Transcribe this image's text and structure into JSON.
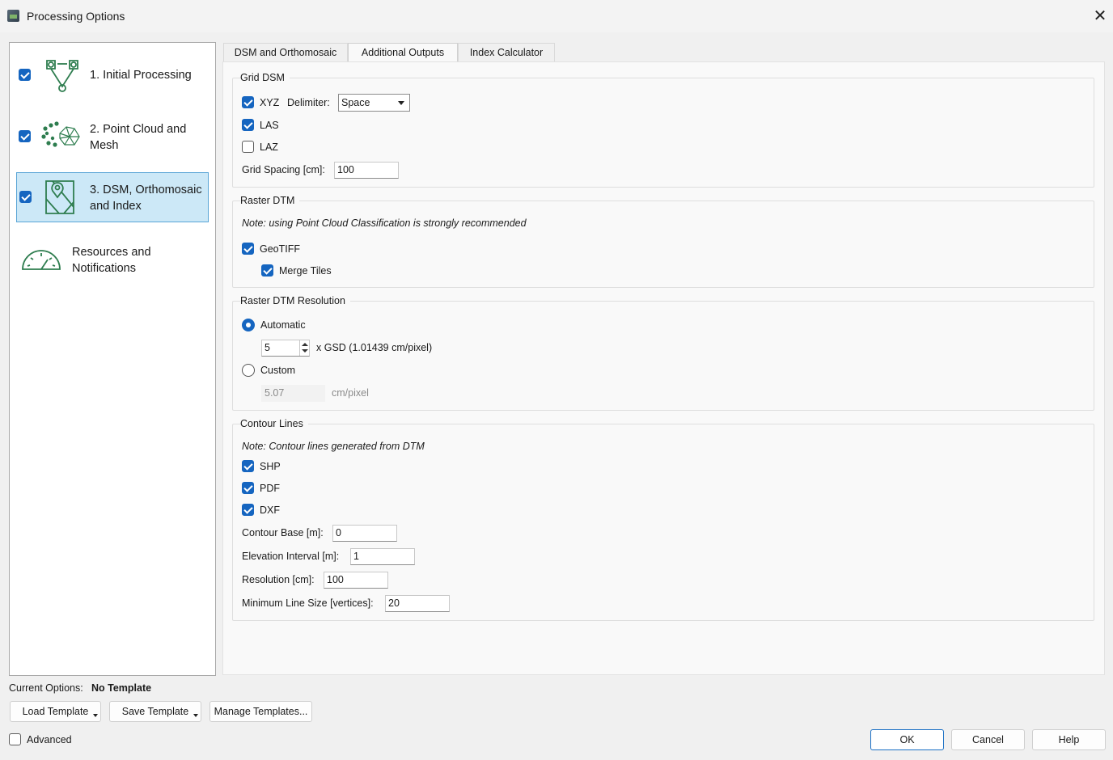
{
  "window": {
    "title": "Processing Options",
    "close_glyph": "✕"
  },
  "nav": {
    "items": [
      {
        "label_line1": "1. Initial Processing",
        "label_line2": "",
        "checked": true,
        "icon": "initial-processing-icon"
      },
      {
        "label_line1": "2. Point Cloud and",
        "label_line2": "Mesh",
        "checked": true,
        "icon": "point-cloud-icon"
      },
      {
        "label_line1": "3. DSM, Orthomosaic",
        "label_line2": "and Index",
        "checked": true,
        "selected": true,
        "icon": "dsm-map-icon"
      },
      {
        "label_line1": "Resources and",
        "label_line2": "Notifications",
        "icon": "gauge-icon"
      }
    ]
  },
  "tabs": [
    "DSM and Orthomosaic",
    "Additional Outputs",
    "Index Calculator"
  ],
  "active_tab": "Additional Outputs",
  "grid_dsm": {
    "title": "Grid DSM",
    "xyz_label": "XYZ",
    "xyz_checked": true,
    "delimiter_label": "Delimiter:",
    "delimiter_value": "Space",
    "las_label": "LAS",
    "las_checked": true,
    "laz_label": "LAZ",
    "laz_checked": false,
    "spacing_label": "Grid Spacing [cm]:",
    "spacing_value": "100"
  },
  "raster_dtm": {
    "title": "Raster DTM",
    "note": "Note: using Point Cloud Classification is strongly recommended",
    "geotiff_label": "GeoTIFF",
    "geotiff_checked": true,
    "merge_label": "Merge Tiles",
    "merge_checked": true
  },
  "raster_res": {
    "title": "Raster DTM Resolution",
    "automatic_label": "Automatic",
    "automatic_selected": true,
    "gsd_value": "5",
    "gsd_label": "x GSD (1.01439 cm/pixel)",
    "custom_label": "Custom",
    "custom_value": "5.07",
    "custom_unit": "cm/pixel"
  },
  "contour": {
    "title": "Contour Lines",
    "note": "Note: Contour lines generated from DTM",
    "shp_label": "SHP",
    "pdf_label": "PDF",
    "dxf_label": "DXF",
    "base_label": "Contour Base [m]:",
    "base_value": "0",
    "interval_label": "Elevation Interval [m]:",
    "interval_value": "1",
    "resolution_label": "Resolution [cm]:",
    "resolution_value": "100",
    "minsize_label": "Minimum Line Size [vertices]:",
    "minsize_value": "20"
  },
  "footer": {
    "current_label": "Current Options:",
    "current_value": "No Template",
    "load_template": "Load Template",
    "save_template": "Save Template",
    "manage_templates": "Manage Templates...",
    "advanced_label": "Advanced",
    "advanced_checked": false,
    "ok": "OK",
    "cancel": "Cancel",
    "help": "Help"
  },
  "colors": {
    "accent": "#1565c0",
    "selected_bg": "#cce8f7",
    "icon_green": "#2e7d4f"
  }
}
